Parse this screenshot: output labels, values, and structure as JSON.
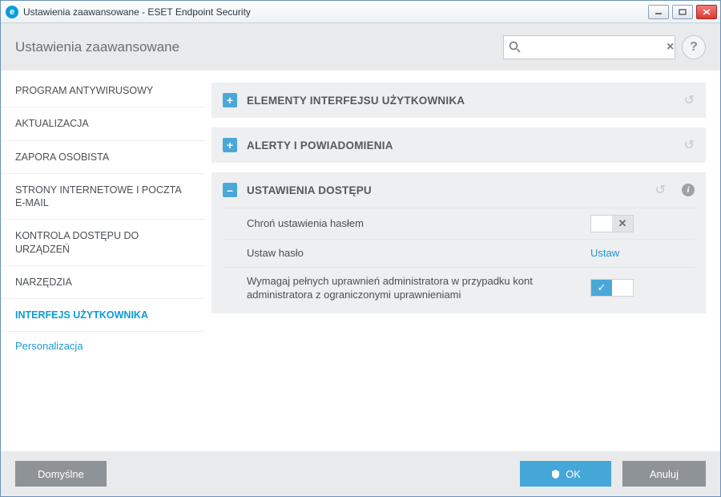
{
  "window": {
    "title": "Ustawienia zaawansowane - ESET Endpoint Security"
  },
  "header": {
    "title": "Ustawienia zaawansowane",
    "search_placeholder": ""
  },
  "sidebar": {
    "items": [
      {
        "label": "PROGRAM ANTYWIRUSOWY"
      },
      {
        "label": "AKTUALIZACJA"
      },
      {
        "label": "ZAPORA OSOBISTA"
      },
      {
        "label": "STRONY INTERNETOWE I POCZTA E-MAIL"
      },
      {
        "label": "KONTROLA DOSTĘPU DO URZĄDZEŃ"
      },
      {
        "label": "NARZĘDZIA"
      },
      {
        "label": "INTERFEJS UŻYTKOWNIKA"
      }
    ],
    "sub": {
      "label": "Personalizacja"
    }
  },
  "panels": [
    {
      "title": "ELEMENTY INTERFEJSU UŻYTKOWNIKA",
      "expanded": false
    },
    {
      "title": "ALERTY I POWIADOMIENIA",
      "expanded": false
    },
    {
      "title": "USTAWIENIA DOSTĘPU",
      "expanded": true,
      "rows": [
        {
          "label": "Chroń ustawienia hasłem",
          "control": "toggle-off"
        },
        {
          "label": "Ustaw hasło",
          "control": "link",
          "link_text": "Ustaw"
        },
        {
          "label": "Wymagaj pełnych uprawnień administratora w przypadku kont administratora z ograniczonymi uprawnieniami",
          "control": "toggle-on"
        }
      ]
    }
  ],
  "footer": {
    "default_label": "Domyślne",
    "ok_label": "OK",
    "cancel_label": "Anuluj"
  }
}
